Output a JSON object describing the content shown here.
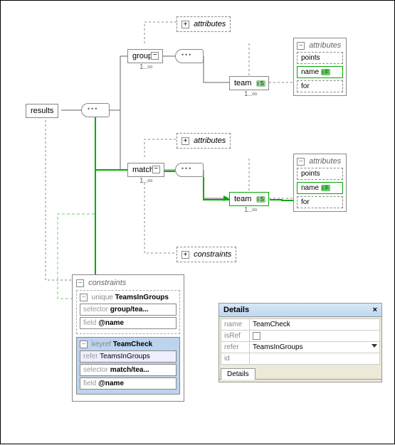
{
  "root": {
    "label": "results"
  },
  "group": {
    "label": "group",
    "card": "1..∞",
    "attr_toggle": "+",
    "attr_label": "attributes"
  },
  "match": {
    "label": "match",
    "card": "1..∞",
    "attr_toggle": "+",
    "attr_label": "attributes",
    "con_toggle": "+",
    "con_label": "constraints"
  },
  "team1": {
    "label": "team",
    "card": "1..∞",
    "badge": "i S"
  },
  "team2": {
    "label": "team",
    "card": "1..∞",
    "badge": "i S"
  },
  "attr_panel1": {
    "toggle": "−",
    "title": "attributes",
    "items": [
      {
        "name": "points",
        "hl": false
      },
      {
        "name": "name",
        "hl": true,
        "badge": "i F"
      },
      {
        "name": "for",
        "hl": false
      }
    ]
  },
  "attr_panel2": {
    "toggle": "−",
    "title": "attributes",
    "items": [
      {
        "name": "points",
        "hl": false
      },
      {
        "name": "name",
        "hl": true,
        "badge": "i F"
      },
      {
        "name": "for",
        "hl": false
      }
    ]
  },
  "constraints": {
    "toggle": "−",
    "title": "constraints",
    "blocks": [
      {
        "kind": "unique",
        "name": "TeamsInGroups",
        "selected": false,
        "rows": [
          {
            "k": "selector",
            "v": "group/tea..."
          },
          {
            "k": "field",
            "v": "@name"
          }
        ]
      },
      {
        "kind": "keyref",
        "name": "TeamCheck",
        "selected": true,
        "refer": "TeamsInGroups",
        "rows": [
          {
            "k": "selector",
            "v": "match/tea..."
          },
          {
            "k": "field",
            "v": "@name"
          }
        ]
      }
    ]
  },
  "details": {
    "title": "Details",
    "fields": {
      "name": "TeamCheck",
      "isRef_label": "isRef",
      "refer": "TeamsInGroups",
      "id": ""
    },
    "labels": {
      "name": "name",
      "isRef": "isRef",
      "refer": "refer",
      "id": "id"
    },
    "tab": "Details"
  }
}
